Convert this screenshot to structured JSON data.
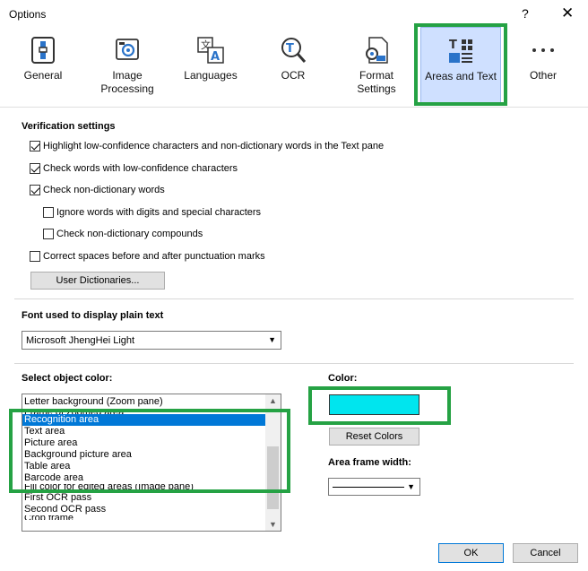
{
  "window": {
    "title": "Options",
    "help": "?",
    "close": "✕"
  },
  "tabs": [
    {
      "label1": "General",
      "label2": ""
    },
    {
      "label1": "Image",
      "label2": "Processing"
    },
    {
      "label1": "Languages",
      "label2": ""
    },
    {
      "label1": "OCR",
      "label2": ""
    },
    {
      "label1": "Format",
      "label2": "Settings"
    },
    {
      "label1": "Areas and Text",
      "label2": ""
    },
    {
      "label1": "Other",
      "label2": ""
    }
  ],
  "verification": {
    "title": "Verification settings",
    "opt1": "Highlight low-confidence characters and non-dictionary words in the Text pane",
    "opt2": "Check words with low-confidence characters",
    "opt3": "Check non-dictionary words",
    "opt4": "Ignore words with digits and special characters",
    "opt5": "Check non-dictionary compounds",
    "opt6": "Correct spaces before and after punctuation marks",
    "user_dict": "User Dictionaries..."
  },
  "font": {
    "title": "Font used to display plain text",
    "value": "Microsoft JhengHei Light"
  },
  "objects": {
    "title": "Select object color:",
    "header": "Letter background (Zoom pane)",
    "cut_top": "Frame of zoomed area",
    "items": [
      "Recognition area",
      "Text area",
      "Picture area",
      "Background picture area",
      "Table area",
      "Barcode area"
    ],
    "cut_mid": "Fill color for edited areas (Image pane)",
    "items2": [
      "First OCR pass",
      "Second OCR pass"
    ],
    "cut_bottom": "Crop frame"
  },
  "color": {
    "title": "Color:",
    "value": "#00e5ee",
    "reset": "Reset Colors",
    "frame_title": "Area frame width:"
  },
  "footer": {
    "ok": "OK",
    "cancel": "Cancel"
  }
}
